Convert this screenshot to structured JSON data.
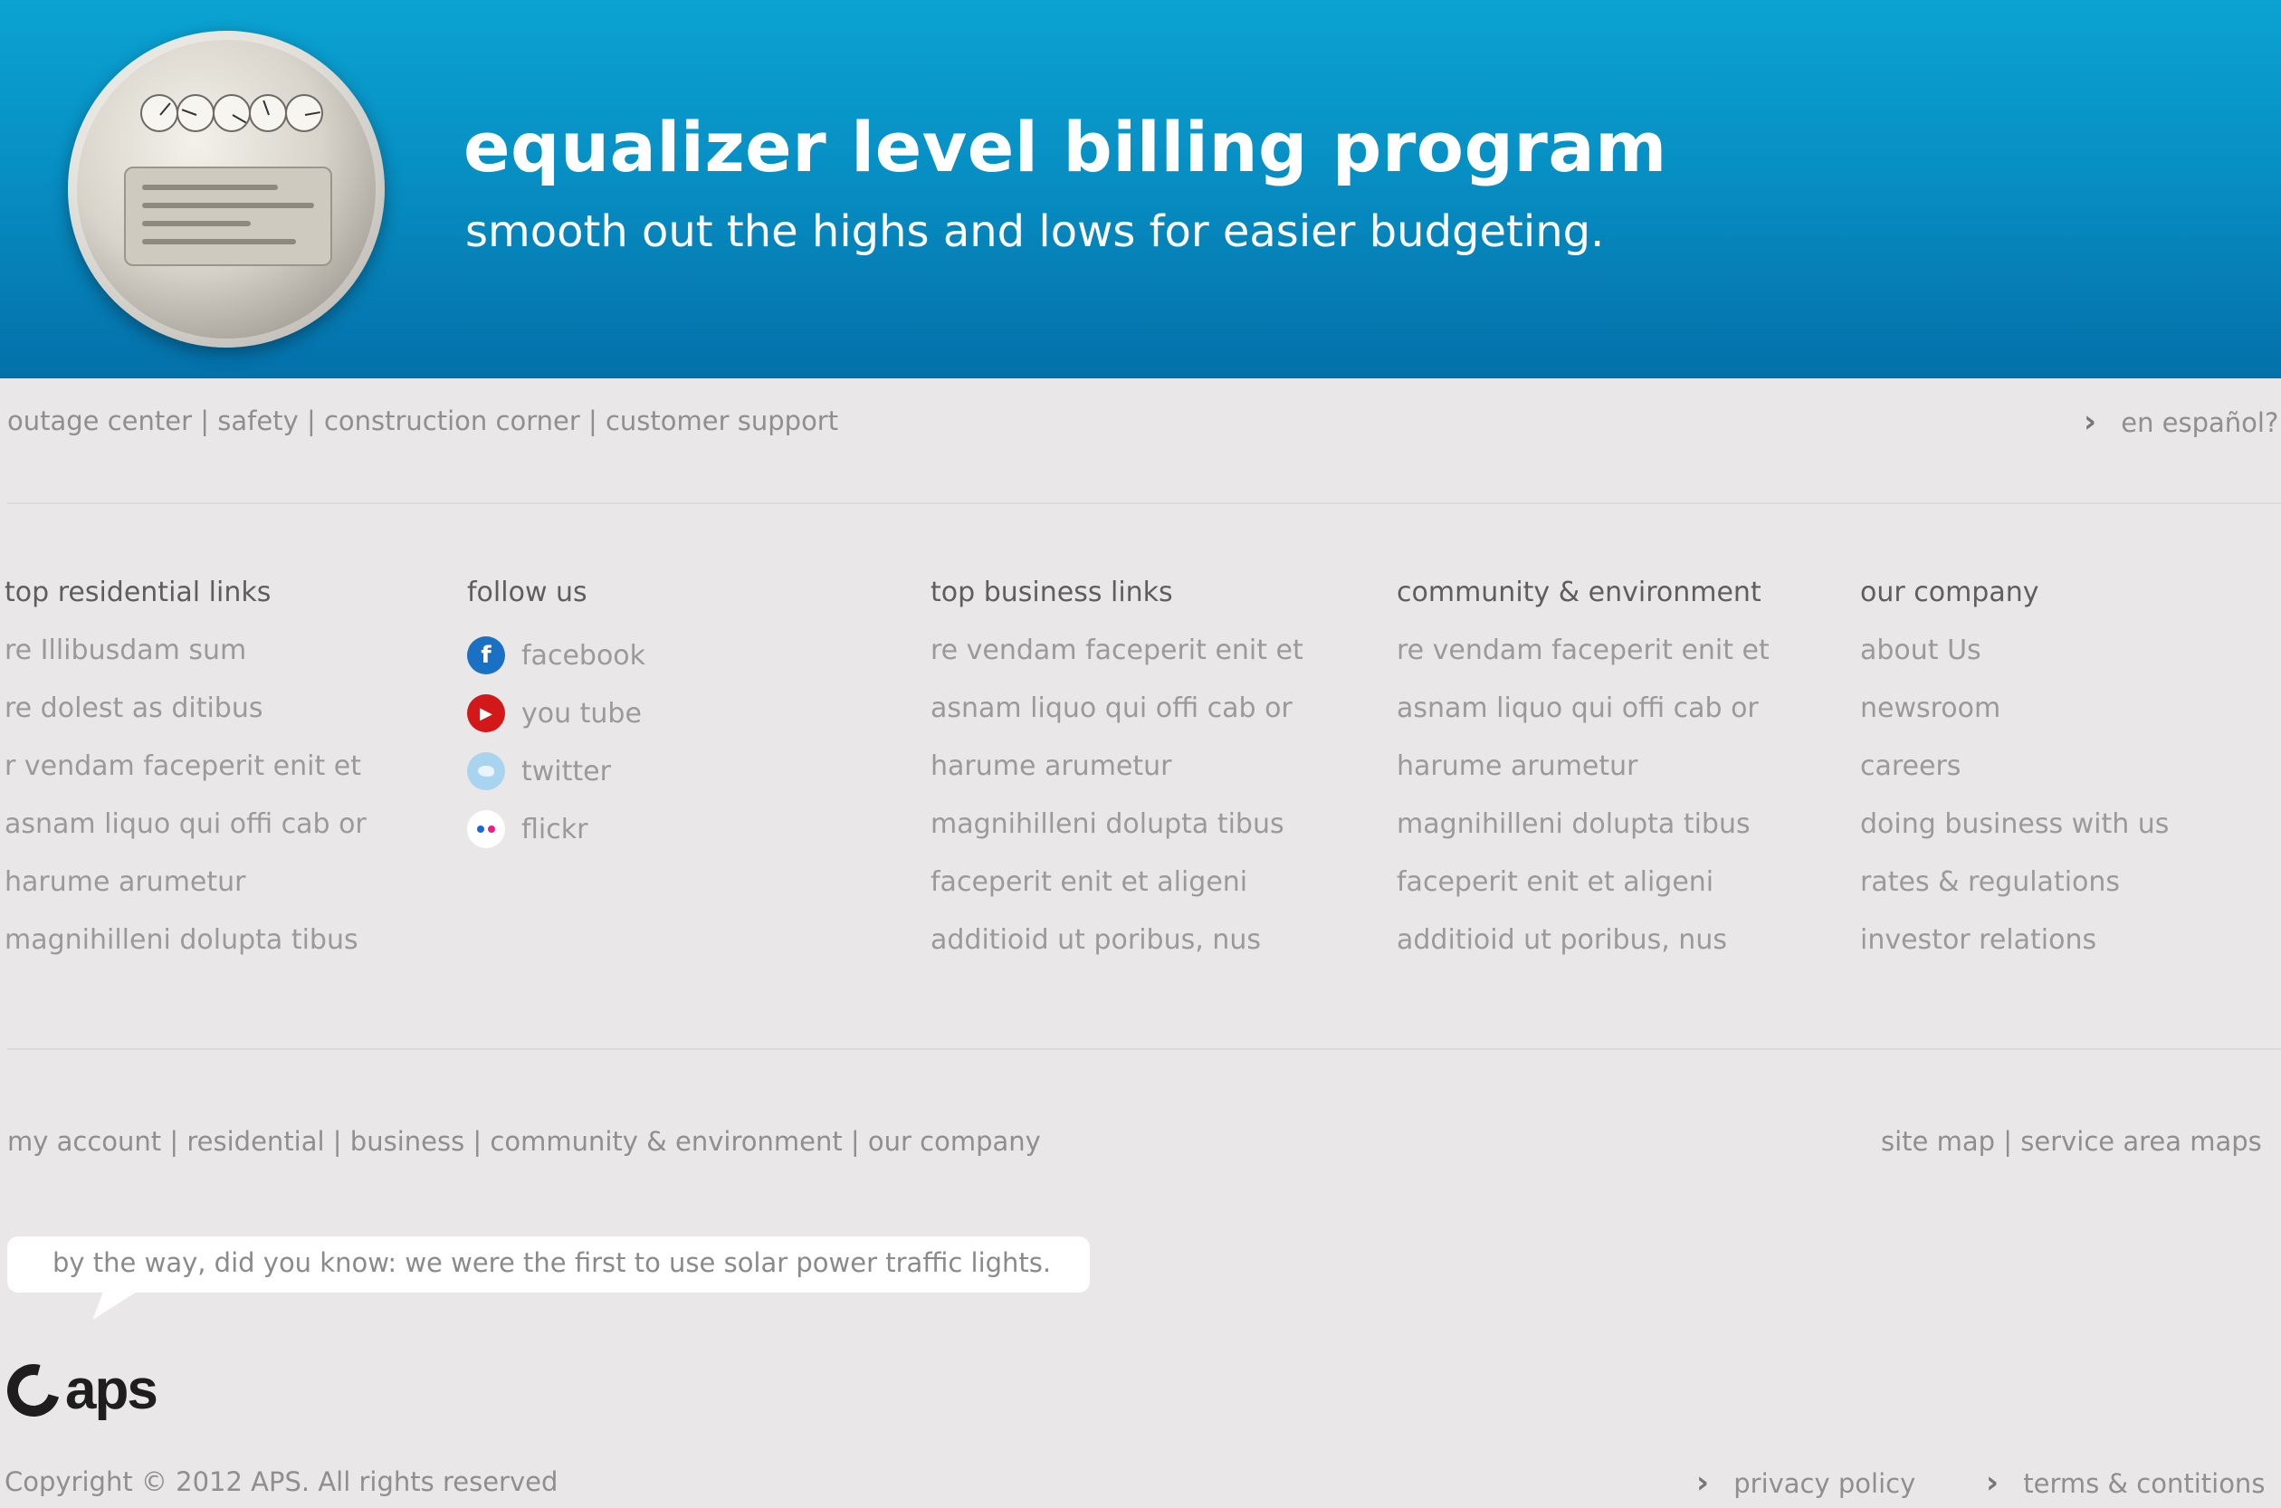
{
  "banner": {
    "title": "equalizer level billing program",
    "subtitle": "smooth out the highs and lows for easier budgeting."
  },
  "utility_nav": {
    "links": [
      "outage center",
      "safety",
      "construction corner",
      "customer support"
    ],
    "language_label": "en español?"
  },
  "columns": [
    {
      "heading": "top residential links",
      "items": [
        "re Illibusdam sum",
        "re dolest as ditibus",
        "r vendam faceperit enit et",
        "asnam liquo qui offi cab or",
        "harume arumetur",
        "magnihilleni dolupta tibus"
      ]
    },
    {
      "heading": "follow us",
      "social": [
        {
          "label": "facebook",
          "icon": "facebook-icon"
        },
        {
          "label": "you tube",
          "icon": "youtube-icon"
        },
        {
          "label": "twitter",
          "icon": "twitter-icon"
        },
        {
          "label": "flickr",
          "icon": "flickr-icon"
        }
      ]
    },
    {
      "heading": "top business links",
      "items": [
        "re vendam faceperit enit et",
        "asnam liquo qui offi cab or",
        "harume arumetur",
        "magnihilleni dolupta tibus",
        "faceperit enit et aligeni",
        "additioid ut poribus, nus"
      ]
    },
    {
      "heading": "community & environment",
      "items": [
        "re vendam faceperit enit et",
        "asnam liquo qui offi cab or",
        "harume arumetur",
        "magnihilleni dolupta tibus",
        "faceperit enit et aligeni",
        "additioid ut poribus, nus"
      ]
    },
    {
      "heading": "our company",
      "items": [
        "about Us",
        "newsroom",
        "careers",
        "doing business with us",
        "rates & regulations",
        "investor relations"
      ]
    }
  ],
  "bottom_nav": {
    "links": [
      "my account",
      "residential",
      "business",
      "community & environment",
      "our company"
    ],
    "right_links": [
      "site map",
      "service area maps"
    ]
  },
  "tip": "by the way, did you know: we were the first to use solar power traffic lights.",
  "logo_text": "aps",
  "footer": {
    "copyright": "Copyright © 2012 APS. All rights reserved",
    "privacy": "privacy policy",
    "terms": "terms & contitions"
  },
  "colors": {
    "banner": "#078fc3",
    "background": "#e9e7e8",
    "link_text": "#9a9a9a",
    "heading_text": "#5e5e5e"
  }
}
